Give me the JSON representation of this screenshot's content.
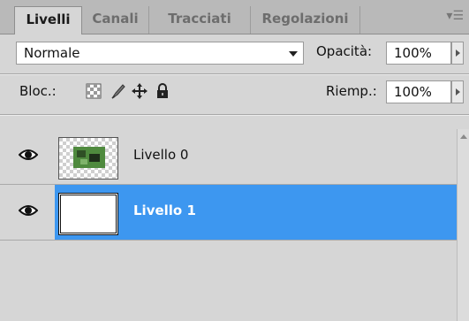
{
  "tabs": [
    {
      "label": "Livelli",
      "active": true
    },
    {
      "label": "Canali",
      "active": false
    },
    {
      "label": "Tracciati",
      "active": false
    },
    {
      "label": "Regolazioni",
      "active": false
    }
  ],
  "blend": {
    "value": "Normale"
  },
  "opacity": {
    "label": "Opacità:",
    "value": "100%"
  },
  "lock": {
    "label": "Bloc.:",
    "icons": [
      "lock-transparent-pixels-icon",
      "lock-image-pixels-icon",
      "lock-position-icon",
      "lock-all-icon"
    ]
  },
  "fill": {
    "label": "Riemp.:",
    "value": "100%"
  },
  "layers": [
    {
      "name": "Livello 0",
      "visible": true,
      "selected": false
    },
    {
      "name": "Livello 1",
      "visible": true,
      "selected": true
    }
  ],
  "colors": {
    "selection": "#3d97f0",
    "panel_bg": "#d6d6d6",
    "tabbar_bg": "#b9b9b9"
  }
}
